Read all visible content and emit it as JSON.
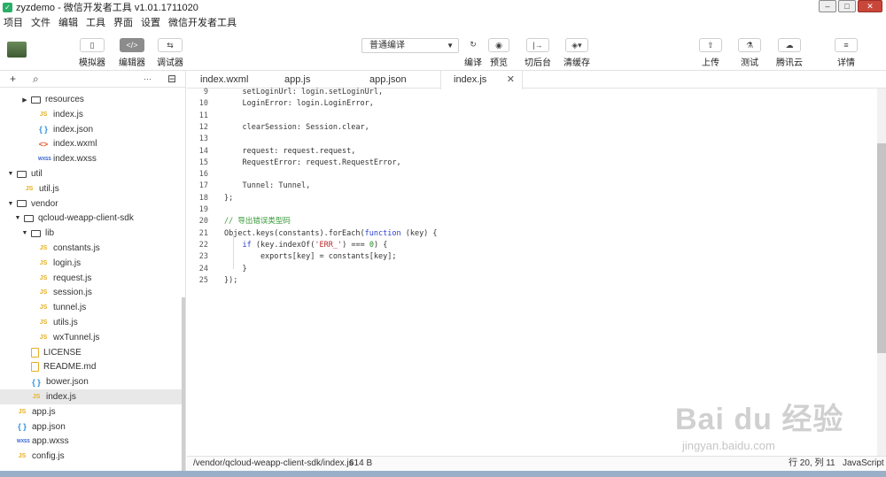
{
  "window": {
    "title": "zyzdemo - 微信开发者工具 v1.01.1711020",
    "controls": [
      "–",
      "□",
      "✕"
    ]
  },
  "menubar": [
    "项目",
    "文件",
    "编辑",
    "工具",
    "界面",
    "设置",
    "微信开发者工具"
  ],
  "toolbar": {
    "left_buttons": [
      {
        "label": "模拟器",
        "icon": "phone-icon",
        "glyph": "▯"
      },
      {
        "label": "编辑器",
        "icon": "code-icon",
        "glyph": "</>"
      },
      {
        "label": "调试器",
        "icon": "debug-icon",
        "glyph": "⇆"
      }
    ],
    "compile_mode": "普通编译",
    "center_buttons": [
      {
        "label": "编译",
        "icon": "refresh-icon",
        "glyph": "↻"
      },
      {
        "label": "预览",
        "icon": "eye-icon",
        "glyph": "◉"
      },
      {
        "label": "切后台",
        "icon": "background-icon",
        "glyph": "|→"
      },
      {
        "label": "清缓存",
        "icon": "layers-icon",
        "glyph": "◈▾"
      }
    ],
    "right_buttons": [
      {
        "label": "上传",
        "icon": "upload-icon",
        "glyph": "⇧"
      },
      {
        "label": "测试",
        "icon": "flask-icon",
        "glyph": "⚗"
      },
      {
        "label": "腾讯云",
        "icon": "cloud-icon",
        "glyph": "☁"
      },
      {
        "label": "详情",
        "icon": "menu-icon",
        "glyph": "≡"
      }
    ]
  },
  "sidebar": {
    "header_icons": [
      "+",
      "⌕",
      "···",
      "⊟"
    ],
    "tree": [
      {
        "name": "resources",
        "type": "folder",
        "depth": 2,
        "open": false
      },
      {
        "name": "index.js",
        "type": "js",
        "depth": 3
      },
      {
        "name": "index.json",
        "type": "json",
        "depth": 3
      },
      {
        "name": "index.wxml",
        "type": "wxml",
        "depth": 3
      },
      {
        "name": "index.wxss",
        "type": "wxss",
        "depth": 3
      },
      {
        "name": "util",
        "type": "folder",
        "depth": 0,
        "open": true
      },
      {
        "name": "util.js",
        "type": "js",
        "depth": 1
      },
      {
        "name": "vendor",
        "type": "folder",
        "depth": 0,
        "open": true
      },
      {
        "name": "qcloud-weapp-client-sdk",
        "type": "folder",
        "depth": 1,
        "open": true
      },
      {
        "name": "lib",
        "type": "folder",
        "depth": 2,
        "open": true
      },
      {
        "name": "constants.js",
        "type": "js",
        "depth": 3
      },
      {
        "name": "login.js",
        "type": "js",
        "depth": 3
      },
      {
        "name": "request.js",
        "type": "js",
        "depth": 3
      },
      {
        "name": "session.js",
        "type": "js",
        "depth": 3
      },
      {
        "name": "tunnel.js",
        "type": "js",
        "depth": 3
      },
      {
        "name": "utils.js",
        "type": "js",
        "depth": 3
      },
      {
        "name": "wxTunnel.js",
        "type": "js",
        "depth": 3
      },
      {
        "name": "LICENSE",
        "type": "doc",
        "depth": 2
      },
      {
        "name": "README.md",
        "type": "doc",
        "depth": 2
      },
      {
        "name": "bower.json",
        "type": "json",
        "depth": 2
      },
      {
        "name": "index.js",
        "type": "js",
        "depth": 2,
        "selected": true
      },
      {
        "name": "app.js",
        "type": "js",
        "depth": 0
      },
      {
        "name": "app.json",
        "type": "json",
        "depth": 0
      },
      {
        "name": "app.wxss",
        "type": "wxss",
        "depth": 0
      },
      {
        "name": "config.js",
        "type": "js",
        "depth": 0
      }
    ]
  },
  "tabs": [
    {
      "label": "index.wxml"
    },
    {
      "label": "app.js"
    },
    {
      "label": "app.json"
    },
    {
      "label": "index.js",
      "active": true,
      "close": "✕"
    }
  ],
  "code": {
    "lines": [
      {
        "n": "9",
        "text": "    setLoginUrl: login.setLoginUrl,"
      },
      {
        "n": "10",
        "text": "    LoginError: login.LoginError,"
      },
      {
        "n": "11",
        "text": ""
      },
      {
        "n": "12",
        "text": "    clearSession: Session.clear,"
      },
      {
        "n": "13",
        "text": ""
      },
      {
        "n": "14",
        "text": "    request: request.request,"
      },
      {
        "n": "15",
        "text": "    RequestError: request.RequestError,"
      },
      {
        "n": "16",
        "text": ""
      },
      {
        "n": "17",
        "text": "    Tunnel: Tunnel,"
      },
      {
        "n": "18",
        "text": "};"
      },
      {
        "n": "19",
        "text": ""
      },
      {
        "n": "20",
        "text": "// 导出错误类型码",
        "kind": "comment"
      },
      {
        "n": "21",
        "text": "Object.keys(constants).forEach(function (key) {"
      },
      {
        "n": "22",
        "text": "    if (key.indexOf('ERR_') === 0) {"
      },
      {
        "n": "23",
        "text": "        exports[key] = constants[key];"
      },
      {
        "n": "24",
        "text": "    }"
      },
      {
        "n": "25",
        "text": "});"
      }
    ]
  },
  "status": {
    "path": "/vendor/qcloud-weapp-client-sdk/index.js",
    "size": "614 B",
    "cursor": "行 20, 列 11",
    "language": "JavaScript"
  },
  "watermark": {
    "main": "Bai du 经验",
    "sub": "jingyan.baidu.com"
  }
}
